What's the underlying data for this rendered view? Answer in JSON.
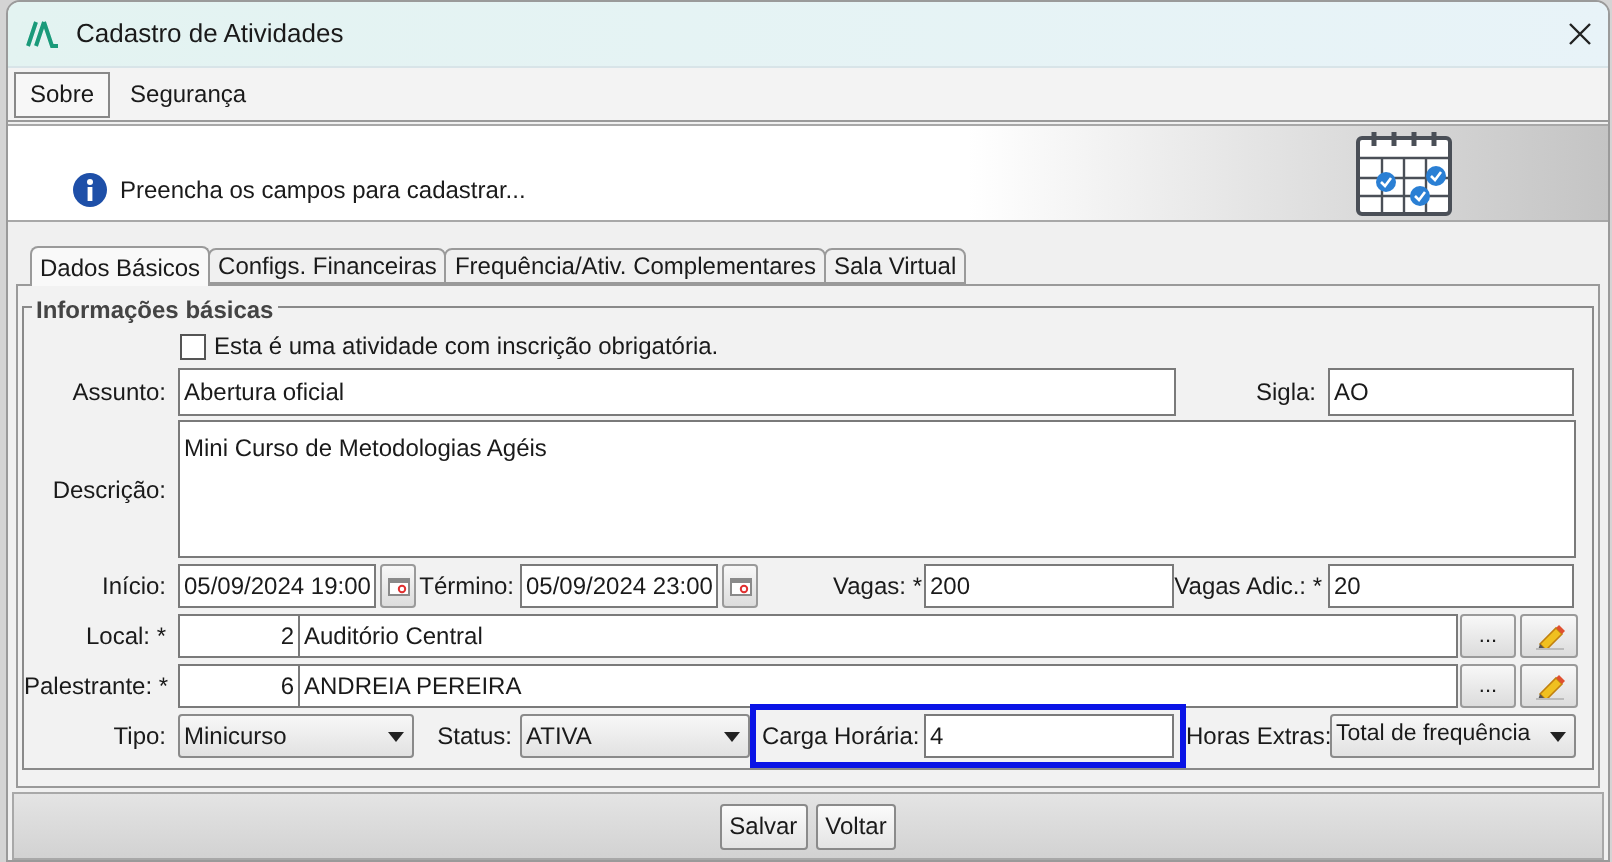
{
  "window": {
    "title": "Cadastro de Atividades"
  },
  "menu": [
    {
      "label": "Sobre",
      "selected": true
    },
    {
      "label": "Segurança",
      "selected": false
    }
  ],
  "header": {
    "message": "Preencha os campos para cadastrar..."
  },
  "tabs": [
    {
      "label": "Dados Básicos",
      "selected": true
    },
    {
      "label": "Configs. Financeiras",
      "selected": false
    },
    {
      "label": "Frequência/Ativ. Complementares",
      "selected": false
    },
    {
      "label": "Sala Virtual",
      "selected": false
    }
  ],
  "group": {
    "title": "Informações básicas"
  },
  "mandatory_checkbox": {
    "label": "Esta é uma atividade com inscrição obrigatória.",
    "checked": false
  },
  "assunto": {
    "label": "Assunto:",
    "value": "Abertura oficial"
  },
  "sigla": {
    "label": "Sigla:",
    "value": "AO"
  },
  "descricao": {
    "label": "Descrição:",
    "value": "Mini Curso de Metodologias Agéis"
  },
  "inicio": {
    "label": "Início:",
    "value": "05/09/2024 19:00"
  },
  "termino": {
    "label": "Término:",
    "value": "05/09/2024 23:00"
  },
  "vagas": {
    "label": "Vagas: *",
    "value": "200"
  },
  "vagas_adic": {
    "label": "Vagas Adic.: *",
    "value": "20"
  },
  "local": {
    "label": "Local: *",
    "code": "2",
    "name": "Auditório Central",
    "browse_button": "..."
  },
  "palestrante": {
    "label": "Palestrante: *",
    "code": "6",
    "name": "ANDREIA PEREIRA",
    "browse_button": "..."
  },
  "tipo": {
    "label": "Tipo:",
    "value": "Minicurso"
  },
  "status": {
    "label": "Status:",
    "value": "ATIVA"
  },
  "carga_horaria": {
    "label": "Carga Horária:",
    "value": "4",
    "highlighted": true
  },
  "horas_extras": {
    "label": "Horas Extras:",
    "value": "Total de frequência"
  },
  "buttons": [
    {
      "label": "Salvar"
    },
    {
      "label": "Voltar"
    }
  ]
}
